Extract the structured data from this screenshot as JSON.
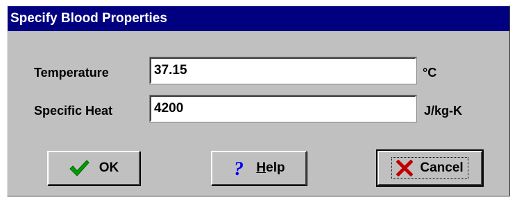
{
  "window": {
    "title": "Specify Blood Properties"
  },
  "fields": {
    "temperature": {
      "label": "Temperature",
      "value": "37.15",
      "unit": "°C"
    },
    "specific_heat": {
      "label": "Specific Heat",
      "value": "4200",
      "unit": "J/kg-K"
    }
  },
  "buttons": {
    "ok": {
      "label": "OK",
      "icon": "checkmark-icon"
    },
    "help": {
      "label": "Help",
      "icon": "question-mark-icon"
    },
    "cancel": {
      "label": "Cancel",
      "icon": "x-icon"
    }
  },
  "colors": {
    "title_bar": "#000080",
    "dialog_face": "#c0c0c0",
    "check_green": "#00a000",
    "help_blue": "#0000ff",
    "cancel_red": "#c00000"
  }
}
